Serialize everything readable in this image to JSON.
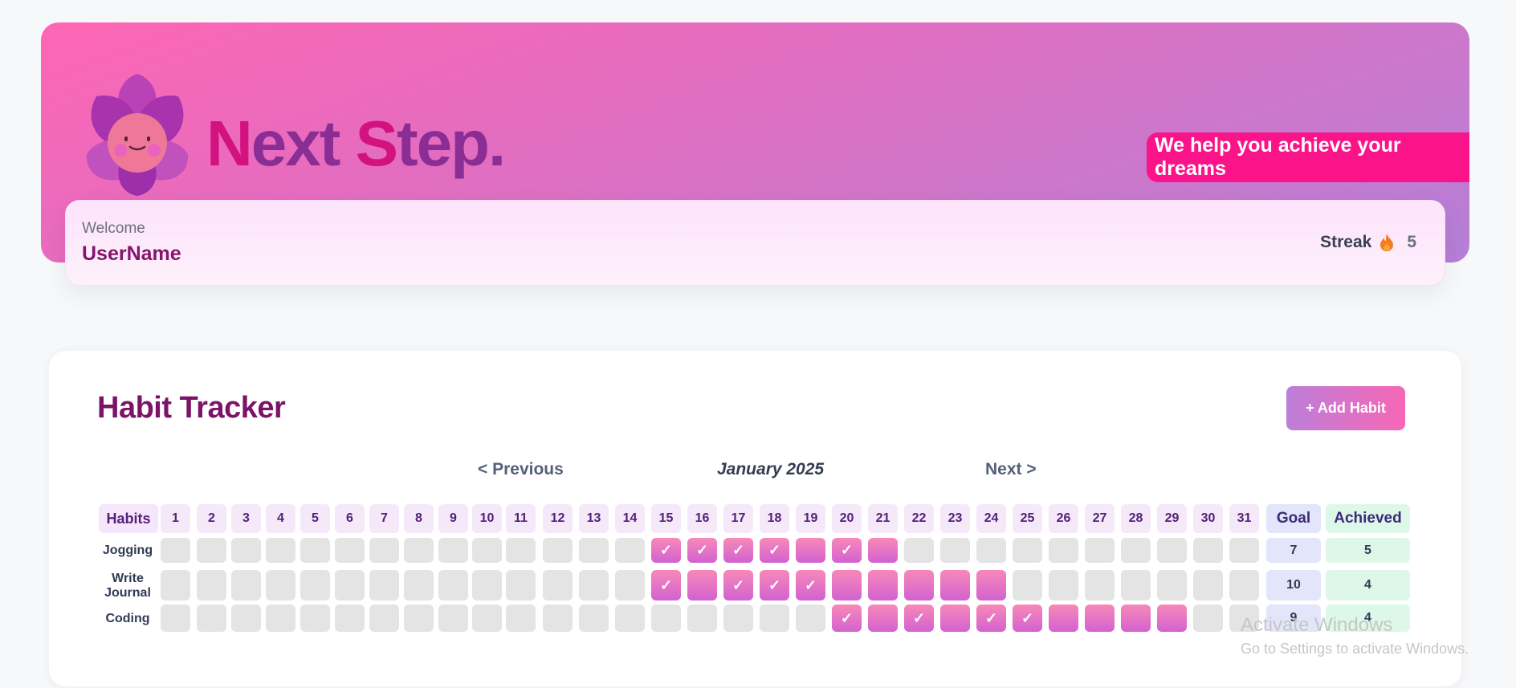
{
  "header": {
    "brand_first": "N",
    "brand_first_rest": "ext ",
    "brand_second": "S",
    "brand_second_rest": "tep.",
    "tagline": "We help you achieve your dreams",
    "welcome_label": "Welcome",
    "user_name": "UserName",
    "streak_label": "Streak",
    "streak_count": "5",
    "logo_icon": "flower-mascot-icon",
    "flame_icon": "flame-icon"
  },
  "tracker": {
    "title": "Habit Tracker",
    "add_button": "+ Add Habit",
    "prev_label": "< Previous",
    "month_label": "January 2025",
    "next_label": "Next >",
    "habits_header": "Habits",
    "goal_header": "Goal",
    "achieved_header": "Achieved",
    "days": [
      "1",
      "2",
      "3",
      "4",
      "5",
      "6",
      "7",
      "8",
      "9",
      "10",
      "11",
      "12",
      "13",
      "14",
      "15",
      "16",
      "17",
      "18",
      "19",
      "20",
      "21",
      "22",
      "23",
      "24",
      "25",
      "26",
      "27",
      "28",
      "29",
      "30",
      "31"
    ],
    "check_mark": "✓",
    "habits": [
      {
        "name": "Jogging",
        "goal": "7",
        "achieved": "5",
        "marked_days": [
          15,
          16,
          17,
          18,
          19,
          20,
          21
        ],
        "checked_days": [
          15,
          16,
          17,
          18,
          20
        ]
      },
      {
        "name": "Write Journal",
        "goal": "10",
        "achieved": "4",
        "marked_days": [
          15,
          16,
          17,
          18,
          19,
          20,
          21,
          22,
          23,
          24
        ],
        "checked_days": [
          15,
          17,
          18,
          19
        ]
      },
      {
        "name": "Coding",
        "goal": "9",
        "achieved": "4",
        "marked_days": [
          20,
          21,
          22,
          23,
          24,
          25,
          26,
          27,
          28,
          29
        ],
        "checked_days": [
          20,
          22,
          24,
          25
        ]
      }
    ]
  },
  "watermark": {
    "title": "Activate Windows",
    "subtitle": "Go to Settings to activate Windows."
  },
  "colors": {
    "accent_pink": "#fb1389",
    "brand_purple": "#8a2e96",
    "title_plum": "#7d1368",
    "cell_on_top": "#f889b8",
    "cell_on_bottom": "#d262d0",
    "cell_off": "#e4e4e4"
  }
}
